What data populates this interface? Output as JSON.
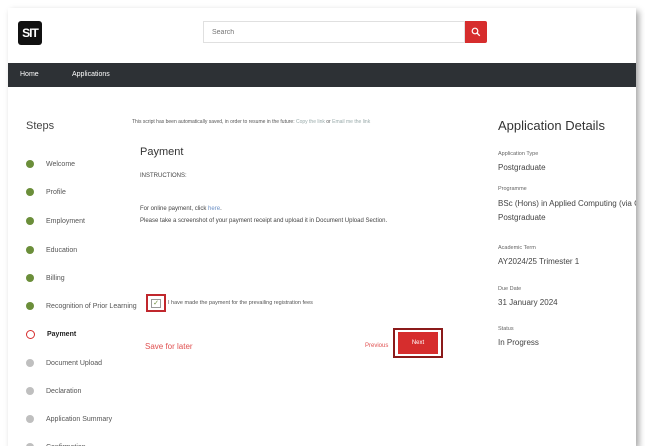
{
  "header": {
    "logo_text": "SIT",
    "search_placeholder": "Search"
  },
  "nav": {
    "items": [
      "Home",
      "Applications"
    ]
  },
  "sidebar": {
    "title": "Steps",
    "steps": [
      {
        "label": "Welcome",
        "status": "done"
      },
      {
        "label": "Profile",
        "status": "done"
      },
      {
        "label": "Employment",
        "status": "done"
      },
      {
        "label": "Education",
        "status": "done"
      },
      {
        "label": "Billing",
        "status": "done"
      },
      {
        "label": "Recognition of Prior Learning",
        "status": "done"
      },
      {
        "label": "Payment",
        "status": "current"
      },
      {
        "label": "Document Upload",
        "status": "pending"
      },
      {
        "label": "Declaration",
        "status": "pending"
      },
      {
        "label": "Application Summary",
        "status": "pending"
      },
      {
        "label": "Confirmation",
        "status": "pending"
      }
    ]
  },
  "main": {
    "autosave_prefix": "This script has been automatically saved, in order to resume in the future:",
    "autosave_copy_link": "Copy the link",
    "autosave_or": "or",
    "autosave_email_link": "Email me the link",
    "title": "Payment",
    "instructions": "INSTRUCTIONS:",
    "online_payment_prefix": "For online payment, click",
    "online_payment_link": "here",
    "online_payment_suffix": ".",
    "screenshot_note": "Please take a screenshot of your payment receipt and upload it in Document Upload Section.",
    "checkbox_label": "I have made the payment for the prevailing registration fees",
    "checkbox_checked": true,
    "save_later": "Save for later",
    "previous": "Previous",
    "next": "Next"
  },
  "details": {
    "title": "Application Details",
    "fields": [
      {
        "label": "Application Type",
        "value": "Postgraduate",
        "value2": ""
      },
      {
        "label": "Programme",
        "value": "BSc (Hons) in Applied Computing (via CS",
        "value2": "Postgraduate"
      },
      {
        "label": "Academic Term",
        "value": "AY2024/25 Trimester 1",
        "value2": ""
      },
      {
        "label": "Due Date",
        "value": "31 January 2024",
        "value2": ""
      },
      {
        "label": "Status",
        "value": "In Progress",
        "value2": ""
      }
    ]
  },
  "colors": {
    "accent": "#d62d2d",
    "nav_bg": "#2d3135",
    "step_done": "#6b8e3a",
    "step_pending": "#bfbfbf"
  }
}
